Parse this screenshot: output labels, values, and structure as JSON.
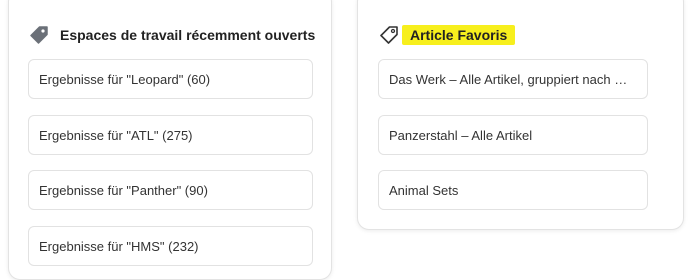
{
  "recent": {
    "icon": "tag-icon",
    "title": "Espaces de travail récemment ouverts",
    "items": [
      {
        "label": "Ergebnisse für \"Leopard\" (60)"
      },
      {
        "label": "Ergebnisse für \"ATL\" (275)"
      },
      {
        "label": "Ergebnisse für \"Panther\" (90)"
      },
      {
        "label": "Ergebnisse für \"HMS\" (232)"
      }
    ]
  },
  "favorites": {
    "icon": "tag-outline-icon",
    "title": "Article Favoris",
    "highlight_color": "#f7ef1d",
    "items": [
      {
        "label": "Das Werk – Alle Artikel, gruppiert nach Marken"
      },
      {
        "label": "Panzerstahl – Alle Artikel"
      },
      {
        "label": "Animal Sets"
      }
    ]
  }
}
